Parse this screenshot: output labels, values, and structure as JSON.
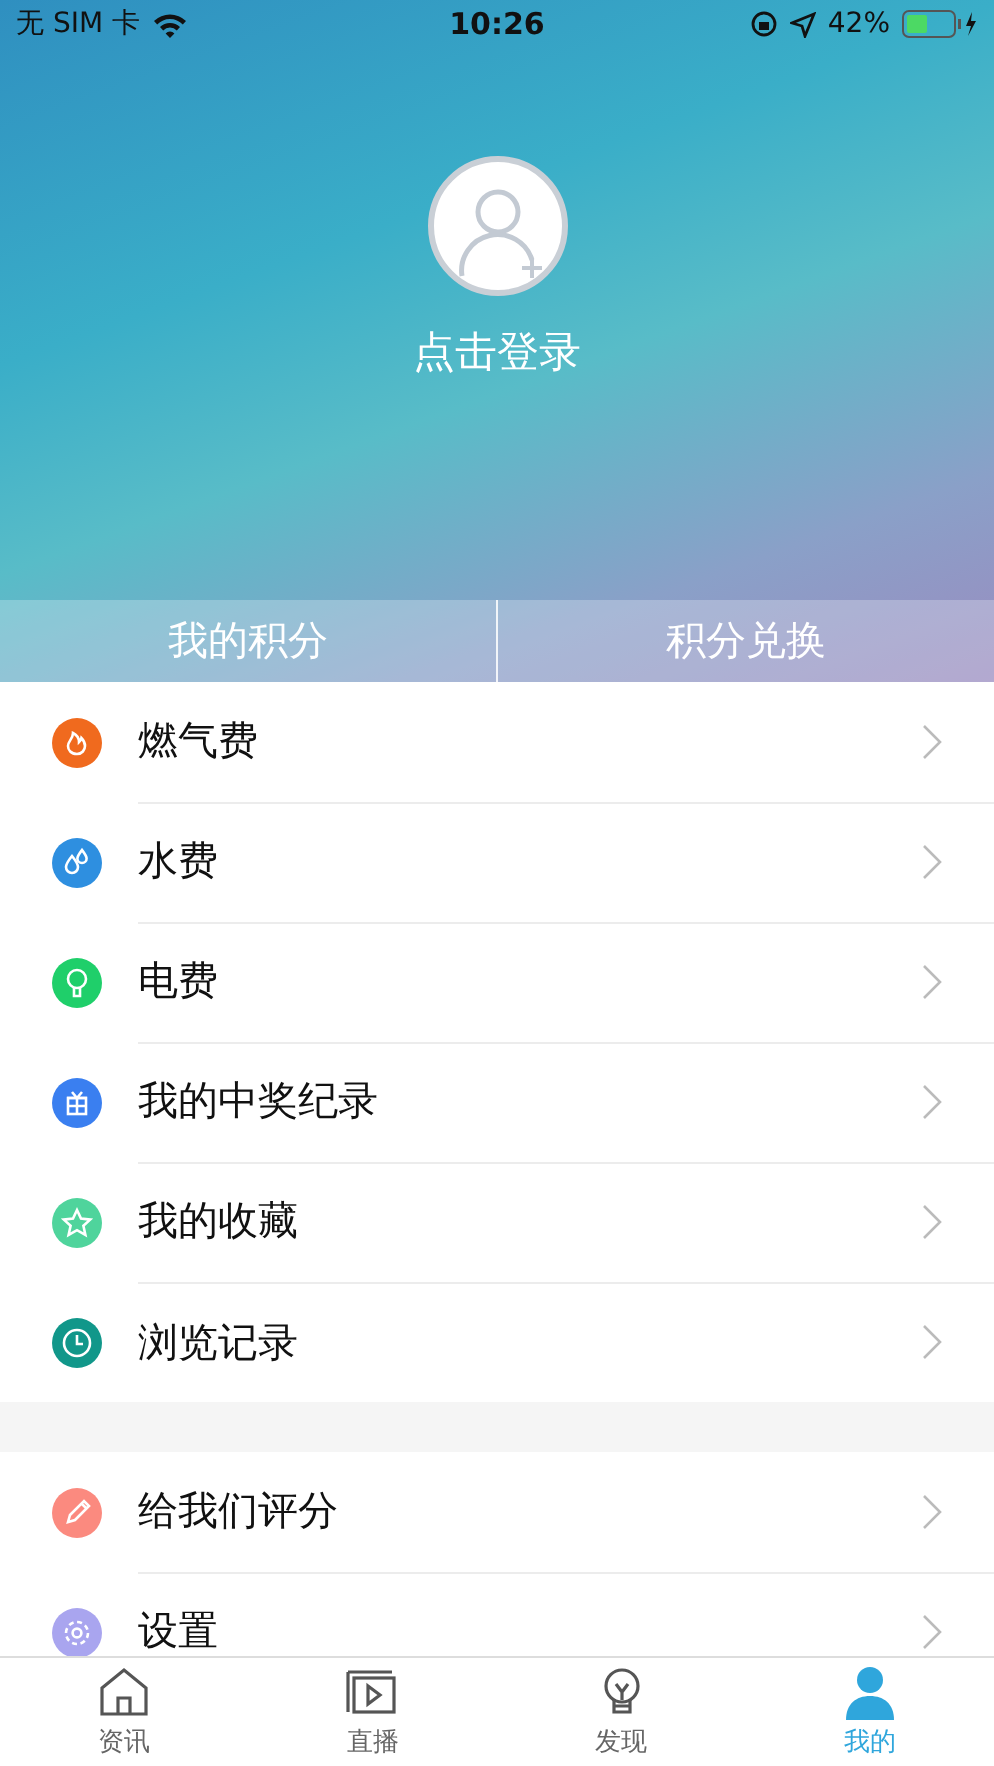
{
  "status_bar": {
    "carrier": "无 SIM 卡",
    "time": "10:26",
    "battery": "42%"
  },
  "profile": {
    "login_label": "点击登录"
  },
  "points_tabs": [
    {
      "label": "我的积分"
    },
    {
      "label": "积分兑换"
    }
  ],
  "menu_groups": [
    {
      "items": [
        {
          "kind": "fire",
          "label": "燃气费",
          "color": "#f06a1e"
        },
        {
          "kind": "water",
          "label": "水费",
          "color": "#2e8fe0"
        },
        {
          "kind": "bulb",
          "label": "电费",
          "color": "#1fcf6a"
        },
        {
          "kind": "gift",
          "label": "我的中奖纪录",
          "color": "#3a7ff0"
        },
        {
          "kind": "star",
          "label": "我的收藏",
          "color": "#4fd49c"
        },
        {
          "kind": "clock",
          "label": "浏览记录",
          "color": "#11978a"
        }
      ]
    },
    {
      "items": [
        {
          "kind": "pencil",
          "label": "给我们评分",
          "color": "#fb8a7f"
        },
        {
          "kind": "gear",
          "label": "设置",
          "color": "#a9a5ef"
        }
      ]
    }
  ],
  "tab_bar": [
    {
      "kind": "home",
      "label": "资讯",
      "selected": false
    },
    {
      "kind": "video",
      "label": "直播",
      "selected": false
    },
    {
      "kind": "bulb",
      "label": "发现",
      "selected": false
    },
    {
      "kind": "person",
      "label": "我的",
      "selected": true
    }
  ]
}
